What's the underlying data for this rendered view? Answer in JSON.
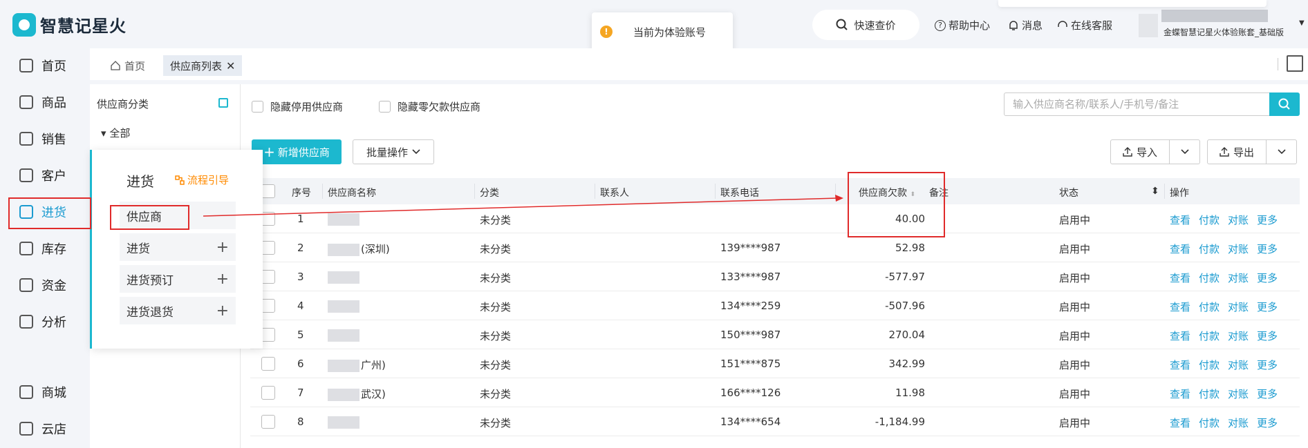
{
  "header": {
    "logo_text": "智慧记星火",
    "toast": "当前为体验账号",
    "quick_price": "快速查价",
    "help": "帮助中心",
    "messages": "消息",
    "service": "在线客服",
    "account_name": "金蝶智慧记星火体验账套_基础版"
  },
  "nav": [
    {
      "label": "首页",
      "icon": "home-icon"
    },
    {
      "label": "商品",
      "icon": "product-icon"
    },
    {
      "label": "销售",
      "icon": "sales-icon"
    },
    {
      "label": "客户",
      "icon": "customer-icon"
    },
    {
      "label": "进货",
      "icon": "purchase-icon"
    },
    {
      "label": "库存",
      "icon": "inventory-icon"
    },
    {
      "label": "资金",
      "icon": "funds-icon"
    },
    {
      "label": "分析",
      "icon": "analytics-icon"
    },
    {
      "label": "商城",
      "icon": "mall-icon"
    },
    {
      "label": "云店",
      "icon": "cloud-store-icon"
    }
  ],
  "tabs": [
    {
      "label": "首页"
    },
    {
      "label": "供应商列表"
    }
  ],
  "category": {
    "title": "供应商分类",
    "all": "全部"
  },
  "flyout": {
    "title": "进货",
    "guide": "流程引导",
    "items": [
      "供应商",
      "进货",
      "进货预订",
      "进货退货"
    ]
  },
  "filters": {
    "hide_disabled": "隐藏停用供应商",
    "hide_zero": "隐藏零欠款供应商",
    "search_placeholder": "输入供应商名称/联系人/手机号/备注"
  },
  "actions": {
    "add": "新增供应商",
    "batch": "批量操作",
    "import": "导入",
    "export": "导出"
  },
  "table": {
    "headers": [
      "序号",
      "供应商名称",
      "分类",
      "联系人",
      "联系电话",
      "供应商欠款",
      "备注",
      "状态",
      "操作"
    ],
    "ops": [
      "查看",
      "付款",
      "对账",
      "更多"
    ],
    "rows": [
      {
        "no": "1",
        "name_suffix": "",
        "category": "未分类",
        "phone": "",
        "debt": "40.00",
        "status": "启用中"
      },
      {
        "no": "2",
        "name_suffix": "(深圳)",
        "category": "未分类",
        "phone": "139****987",
        "debt": "52.98",
        "status": "启用中"
      },
      {
        "no": "3",
        "name_suffix": "",
        "category": "未分类",
        "phone": "133****987",
        "debt": "-577.97",
        "status": "启用中"
      },
      {
        "no": "4",
        "name_suffix": "",
        "category": "未分类",
        "phone": "134****259",
        "debt": "-507.96",
        "status": "启用中"
      },
      {
        "no": "5",
        "name_suffix": "",
        "category": "未分类",
        "phone": "150****987",
        "debt": "270.04",
        "status": "启用中"
      },
      {
        "no": "6",
        "name_suffix": "广州)",
        "category": "未分类",
        "phone": "151****875",
        "debt": "342.99",
        "status": "启用中"
      },
      {
        "no": "7",
        "name_suffix": "武汉)",
        "category": "未分类",
        "phone": "166****126",
        "debt": "11.98",
        "status": "启用中"
      },
      {
        "no": "8",
        "name_suffix": "",
        "category": "未分类",
        "phone": "134****654",
        "debt": "-1,184.99",
        "status": "启用中"
      }
    ]
  },
  "colors": {
    "accent": "#1cb8cf",
    "link": "#1b9bd0",
    "annotation": "#e02a2a",
    "guide": "#ff8a00"
  }
}
